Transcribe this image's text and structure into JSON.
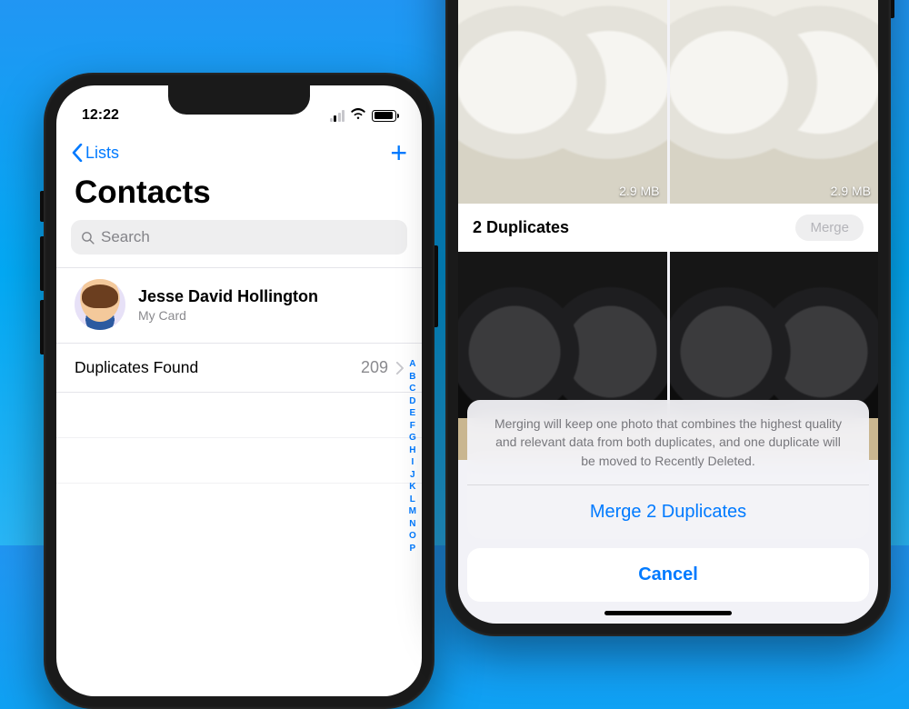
{
  "left": {
    "status": {
      "time": "12:22"
    },
    "nav": {
      "back_label": "Lists"
    },
    "title": "Contacts",
    "search": {
      "placeholder": "Search"
    },
    "me": {
      "name": "Jesse David Hollington",
      "subtitle": "My Card"
    },
    "duplicates": {
      "label": "Duplicates Found",
      "count": "209"
    },
    "index": [
      "A",
      "B",
      "C",
      "D",
      "E",
      "F",
      "G",
      "H",
      "I",
      "J",
      "K",
      "L",
      "M",
      "N",
      "O",
      "P"
    ]
  },
  "right": {
    "group1": {
      "size_badge": "2.9 MB"
    },
    "section": {
      "title": "2 Duplicates",
      "merge_label": "Merge"
    },
    "sheet": {
      "explain": "Merging will keep one photo that combines the highest quality and relevant data from both duplicates, and one duplicate will be moved to Recently Deleted.",
      "action": "Merge 2 Duplicates",
      "cancel": "Cancel"
    }
  }
}
